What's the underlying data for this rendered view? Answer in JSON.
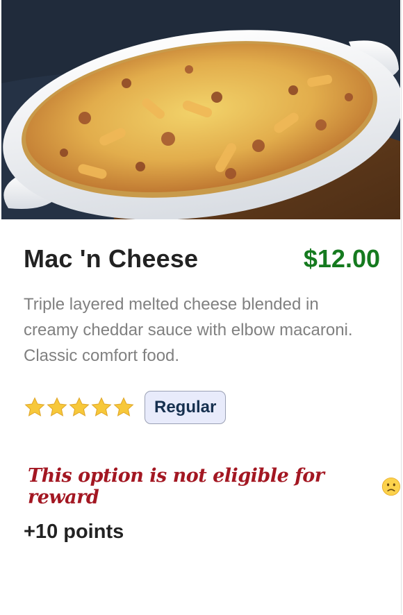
{
  "item": {
    "name": "Mac 'n Cheese",
    "price": "$12.00",
    "description": "Triple layered melted cheese blended in creamy cheddar sauce with elbow macaroni. Classic comfort food.",
    "rating": 5,
    "rating_max": 5,
    "size_badge": "Regular",
    "reward_notice": "This option is not eligible for reward",
    "points": "+10 points"
  },
  "icons": {
    "star": "star-icon",
    "sad_face": "sad-face-icon"
  },
  "colors": {
    "price": "#157a1f",
    "notice": "#a31722",
    "badge_bg": "#e8ebfb",
    "star": "#f7c83a"
  }
}
